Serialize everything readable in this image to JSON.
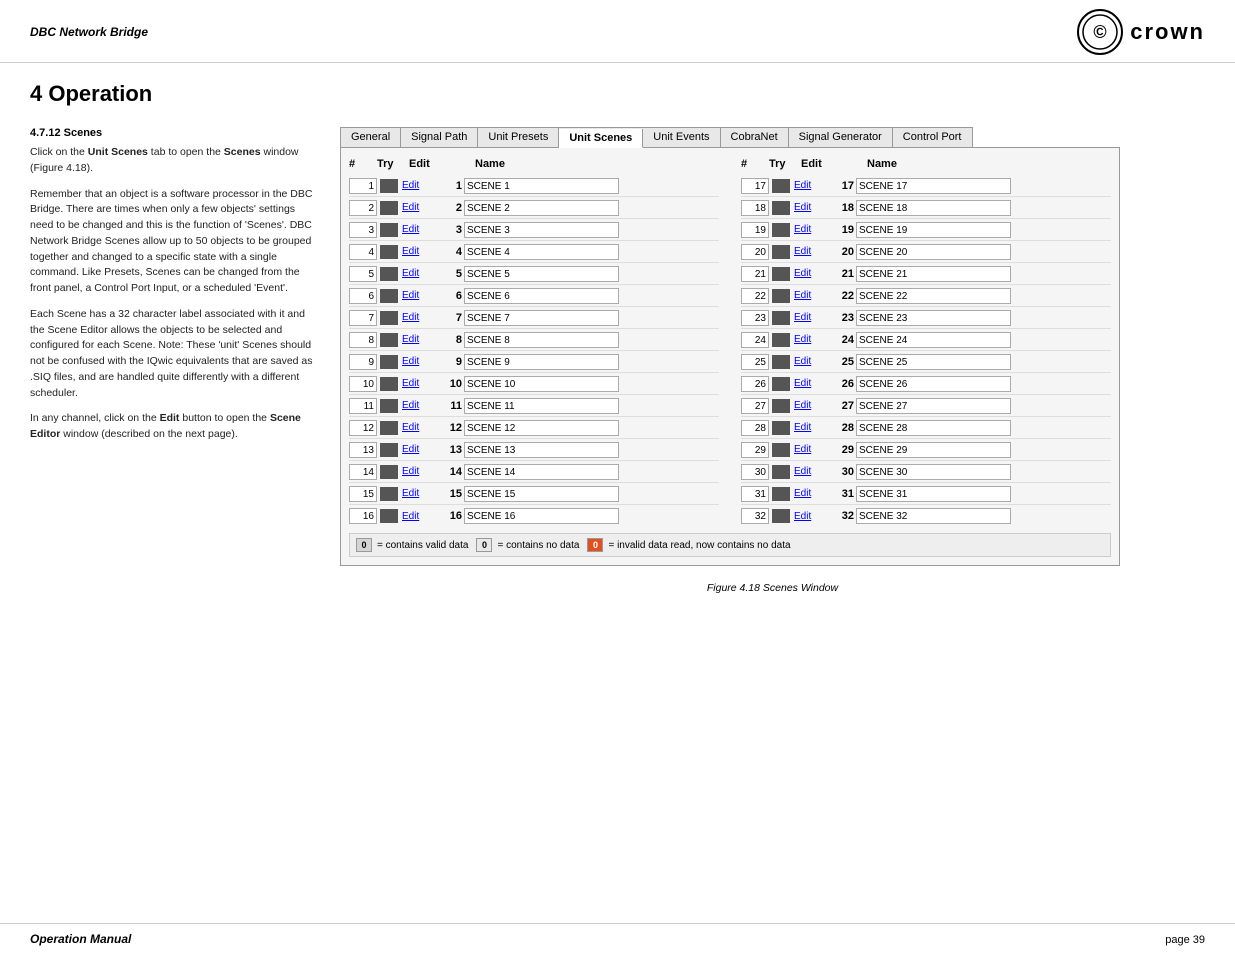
{
  "header": {
    "title": "DBC Network Bridge",
    "footer_left": "Operation Manual",
    "footer_right": "page 39"
  },
  "page": {
    "title": "4 Operation"
  },
  "left_panel": {
    "section": "4.7.12 Scenes",
    "paragraphs": [
      "Click on the <b>Unit Scenes</b> tab to open the <b>Scenes</b> window (Figure 4.18).",
      "Remember that an object is a software processor in the DBC Bridge. There are times when only a few objects' settings need to be changed and this is the function of 'Scenes'. DBC Network Bridge Scenes allow up to 50 objects to be grouped together and changed to a specific state with a single command. Like Presets, Scenes can be changed from the front panel, a Control Port Input, or a scheduled 'Event'.",
      "Each Scene has a 32 character label associated with it and the Scene Editor allows the objects to be selected and configured for each Scene. Note: These 'unit' Scenes should not be confused with the IQwic equivalents that are saved as .SIQ files, and are handled quite differently with a different scheduler.",
      "In any channel, click on the <b>Edit</b> button to open the <b>Scene Editor</b> window (described on the next page)."
    ]
  },
  "tabs": {
    "items": [
      {
        "label": "General",
        "active": false
      },
      {
        "label": "Signal Path",
        "active": false
      },
      {
        "label": "Unit Presets",
        "active": false
      },
      {
        "label": "Unit Scenes",
        "active": true
      },
      {
        "label": "Unit Events",
        "active": false
      },
      {
        "label": "CobraNet",
        "active": false
      },
      {
        "label": "Signal Generator",
        "active": false
      },
      {
        "label": "Control Port",
        "active": false
      }
    ]
  },
  "table": {
    "columns": [
      "#",
      "Try",
      "Edit",
      "Name"
    ],
    "left_scenes": [
      {
        "num": 1,
        "scene_num": 1,
        "name": "SCENE 1"
      },
      {
        "num": 2,
        "scene_num": 2,
        "name": "SCENE 2"
      },
      {
        "num": 3,
        "scene_num": 3,
        "name": "SCENE 3"
      },
      {
        "num": 4,
        "scene_num": 4,
        "name": "SCENE 4"
      },
      {
        "num": 5,
        "scene_num": 5,
        "name": "SCENE 5"
      },
      {
        "num": 6,
        "scene_num": 6,
        "name": "SCENE 6"
      },
      {
        "num": 7,
        "scene_num": 7,
        "name": "SCENE 7"
      },
      {
        "num": 8,
        "scene_num": 8,
        "name": "SCENE 8"
      },
      {
        "num": 9,
        "scene_num": 9,
        "name": "SCENE 9"
      },
      {
        "num": 10,
        "scene_num": 10,
        "name": "SCENE 10"
      },
      {
        "num": 11,
        "scene_num": 11,
        "name": "SCENE 11"
      },
      {
        "num": 12,
        "scene_num": 12,
        "name": "SCENE 12"
      },
      {
        "num": 13,
        "scene_num": 13,
        "name": "SCENE 13"
      },
      {
        "num": 14,
        "scene_num": 14,
        "name": "SCENE 14"
      },
      {
        "num": 15,
        "scene_num": 15,
        "name": "SCENE 15"
      },
      {
        "num": 16,
        "scene_num": 16,
        "name": "SCENE 16"
      }
    ],
    "right_scenes": [
      {
        "num": 17,
        "scene_num": 17,
        "name": "SCENE 17"
      },
      {
        "num": 18,
        "scene_num": 18,
        "name": "SCENE 18"
      },
      {
        "num": 19,
        "scene_num": 19,
        "name": "SCENE 19"
      },
      {
        "num": 20,
        "scene_num": 20,
        "name": "SCENE 20"
      },
      {
        "num": 21,
        "scene_num": 21,
        "name": "SCENE 21"
      },
      {
        "num": 22,
        "scene_num": 22,
        "name": "SCENE 22"
      },
      {
        "num": 23,
        "scene_num": 23,
        "name": "SCENE 23"
      },
      {
        "num": 24,
        "scene_num": 24,
        "name": "SCENE 24"
      },
      {
        "num": 25,
        "scene_num": 25,
        "name": "SCENE 25"
      },
      {
        "num": 26,
        "scene_num": 26,
        "name": "SCENE 26"
      },
      {
        "num": 27,
        "scene_num": 27,
        "name": "SCENE 27"
      },
      {
        "num": 28,
        "scene_num": 28,
        "name": "SCENE 28"
      },
      {
        "num": 29,
        "scene_num": 29,
        "name": "SCENE 29"
      },
      {
        "num": 30,
        "scene_num": 30,
        "name": "SCENE 30"
      },
      {
        "num": 31,
        "scene_num": 31,
        "name": "SCENE 31"
      },
      {
        "num": 32,
        "scene_num": 32,
        "name": "SCENE 32"
      }
    ]
  },
  "legend": {
    "valid_label": "0",
    "valid_text": "= contains valid data",
    "nodata_label": "0",
    "nodata_text": "= contains no data",
    "invalid_label": "0",
    "invalid_text": "= invalid data read, now contains no data"
  },
  "figure_caption": "Figure 4.18 Scenes Window"
}
